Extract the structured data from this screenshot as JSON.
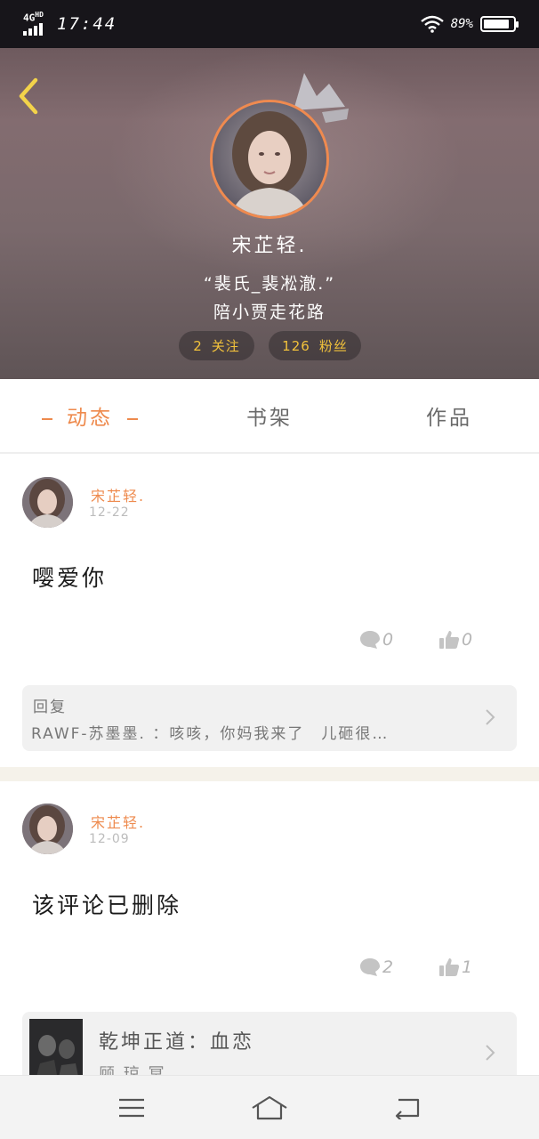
{
  "status_bar": {
    "network": "4G",
    "network_sub": "HD",
    "time": "17:44",
    "battery": "89%",
    "battery_level": 0.89
  },
  "profile": {
    "nickname": "宋芷轻.",
    "signature_line1": "“裴氏_裴凇澈.”",
    "signature_line2": "陪小贾走花路",
    "following_count": "2",
    "following_label": "关注",
    "fans_count": "126",
    "fans_label": "粉丝"
  },
  "main": {
    "tabs": [
      {
        "label": "动态",
        "active": true
      },
      {
        "label": "书架",
        "active": false
      },
      {
        "label": "作品",
        "active": false
      }
    ]
  },
  "feed": [
    {
      "author": "宋芷轻.",
      "date": "12-22",
      "text": "嘤爱你",
      "comments": "0",
      "likes": "0",
      "reply_title": "回复",
      "reply_text": "RAWF-苏墨墨. ：咳咳，你妈我来了　儿砸很…"
    },
    {
      "author": "宋芷轻.",
      "date": "12-09",
      "text": "该评论已删除",
      "comments": "2",
      "likes": "1",
      "book_title": "乾坤正道：血恋",
      "book_author": "顾 琼 冥"
    }
  ],
  "colors": {
    "accent": "#ee8a4d",
    "pill_text": "#f2c23b",
    "back_arrow": "#f3d34a",
    "avatar_ring": "#ef8a4f"
  },
  "icons": {
    "back": "chevron-left-icon",
    "crown": "crown-icon",
    "comment": "comment-bubble-icon",
    "like": "thumbs-up-icon",
    "chevron": "chevron-right-icon",
    "nav_menu": "menu-icon",
    "nav_home": "home-icon",
    "nav_back": "back-icon"
  }
}
